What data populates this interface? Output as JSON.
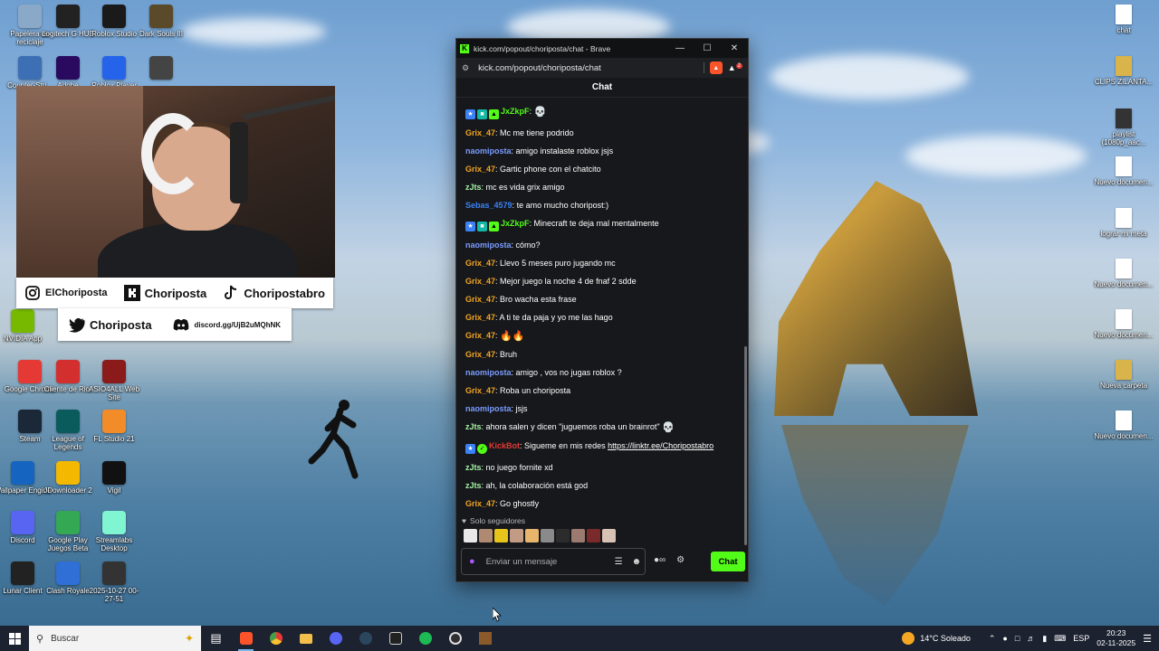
{
  "desktop": {
    "left_icons": [
      {
        "label": "Papelera de reciclaje",
        "icon": "recycle-bin-icon",
        "color": "#8aa9c8"
      },
      {
        "label": "Logitech G HUB",
        "icon": "logitech-icon",
        "color": "#222222"
      },
      {
        "label": "Roblox Studio",
        "icon": "roblox-studio-icon",
        "color": "#1a1a1a"
      },
      {
        "label": "Dark Souls III",
        "icon": "dark-souls-icon",
        "color": "#5a4a2a"
      },
      {
        "label": "Counter-Stri...",
        "icon": "cs-icon",
        "color": "#3c6fb4"
      },
      {
        "label": "Adobe",
        "icon": "premiere-icon",
        "color": "#2a0a5e"
      },
      {
        "label": "Roblox Player",
        "icon": "roblox-icon",
        "color": "#2563eb"
      },
      {
        "label": "...",
        "icon": "video-file-icon",
        "color": "#444444"
      },
      {
        "label": "NVIDIA App",
        "icon": "nvidia-icon",
        "color": "#76b900"
      },
      {
        "label": "Google Chrome",
        "icon": "chrome-icon",
        "color": "#e53935"
      },
      {
        "label": "Cliente de Riot",
        "icon": "riot-icon",
        "color": "#d32f2f"
      },
      {
        "label": "ASIO4ALL Web Site",
        "icon": "asio-icon",
        "color": "#8b1a1a"
      },
      {
        "label": "Steam",
        "icon": "steam-icon",
        "color": "#1b2838"
      },
      {
        "label": "League of Legends",
        "icon": "lol-icon",
        "color": "#0a5c5c"
      },
      {
        "label": "FL Studio 21",
        "icon": "fl-studio-icon",
        "color": "#f28c28"
      },
      {
        "label": "Wallpaper Engine",
        "icon": "wallpaper-engine-icon",
        "color": "#1565c0"
      },
      {
        "label": "JDownloader 2",
        "icon": "jdownloader-icon",
        "color": "#f5b800"
      },
      {
        "label": "Vigil",
        "icon": "vigil-icon",
        "color": "#111111"
      },
      {
        "label": "Discord",
        "icon": "discord-icon",
        "color": "#5865f2"
      },
      {
        "label": "Google Play Juegos Beta",
        "icon": "google-play-icon",
        "color": "#34a853"
      },
      {
        "label": "Streamlabs Desktop",
        "icon": "streamlabs-icon",
        "color": "#80f5d2"
      },
      {
        "label": "Lunar Client",
        "icon": "lunar-icon",
        "color": "#222222"
      },
      {
        "label": "Clash Royale",
        "icon": "clash-royale-icon",
        "color": "#2f6fd6"
      },
      {
        "label": "2025-10-27 00-27-51",
        "icon": "video-file-icon",
        "color": "#333333"
      }
    ],
    "right_icons": [
      {
        "label": "chat",
        "icon": "document-icon",
        "color": "#ffffff"
      },
      {
        "label": "CLIPS ZILANTA...",
        "icon": "folder-zip-icon",
        "color": "#d9b44a"
      },
      {
        "label": "playlist (1080p_aac...",
        "icon": "video-file-icon",
        "color": "#333333"
      },
      {
        "label": "Nuevo documen...",
        "icon": "document-icon",
        "color": "#ffffff"
      },
      {
        "label": "lograr mi meta",
        "icon": "document-icon",
        "color": "#ffffff"
      },
      {
        "label": "Nuevo documen...",
        "icon": "document-icon",
        "color": "#ffffff"
      },
      {
        "label": "Nuevo documen...",
        "icon": "document-icon",
        "color": "#ffffff"
      },
      {
        "label": "Nueva carpeta",
        "icon": "folder-zip-icon",
        "color": "#d9b44a"
      },
      {
        "label": "Nuevo documen...",
        "icon": "document-icon",
        "color": "#ffffff"
      }
    ]
  },
  "overlay": {
    "instagram": "ElChoriposta",
    "kick": "Choriposta",
    "tiktok": "Choripostabro",
    "twitter": "Choriposta",
    "discord": "discord.gg/UjB2uMQhNK"
  },
  "browser": {
    "title": "kick.com/popout/choriposta/chat - Brave",
    "url": "kick.com/popout/choriposta/chat",
    "shield_count": "2",
    "chat_header": "Chat",
    "messages": [
      {
        "user": "JxZkpF",
        "color": "#53fc18",
        "badges": true,
        "text": "",
        "emote": "💀"
      },
      {
        "user": "Grix_47",
        "color": "#f5a623",
        "text": "Mc me tiene podrido"
      },
      {
        "user": "naomiposta",
        "color": "#7c9cff",
        "text": "amigo instalaste roblox jsjs"
      },
      {
        "user": "Grix_47",
        "color": "#f5a623",
        "text": "Gartic phone con el chatcito"
      },
      {
        "user": "zJts",
        "color": "#a6f3a6",
        "text": "mc es vida grix amigo"
      },
      {
        "user": "Sebas_4579",
        "color": "#3b82f6",
        "text": "te amo mucho choripost:)"
      },
      {
        "user": "JxZkpF",
        "color": "#53fc18",
        "badges": true,
        "text": "Minecraft te deja mal mentalmente"
      },
      {
        "user": "naomiposta",
        "color": "#7c9cff",
        "text": "cómo?"
      },
      {
        "user": "Grix_47",
        "color": "#f5a623",
        "text": "Llevo 5 meses puro jugando mc"
      },
      {
        "user": "Grix_47",
        "color": "#f5a623",
        "text": "Mejor juego la noche 4 de fnaf 2 sdde"
      },
      {
        "user": "Grix_47",
        "color": "#f5a623",
        "text": "Bro wacha esta frase"
      },
      {
        "user": "Grix_47",
        "color": "#f5a623",
        "text": "A ti te da paja y yo me las hago"
      },
      {
        "user": "Grix_47",
        "color": "#f5a623",
        "text": "",
        "emote": "🔥🔥"
      },
      {
        "user": "Grix_47",
        "color": "#f5a623",
        "text": "Bruh"
      },
      {
        "user": "naomiposta",
        "color": "#7c9cff",
        "text": "amigo , vos no jugas roblox ?"
      },
      {
        "user": "Grix_47",
        "color": "#f5a623",
        "text": "Roba un choriposta"
      },
      {
        "user": "naomiposta",
        "color": "#7c9cff",
        "text": "jsjs"
      },
      {
        "user": "zJts",
        "color": "#a6f3a6",
        "text": "ahora salen y dicen \"juguemos roba un brainrot\"",
        "emote": "💀"
      },
      {
        "user": "KickBot",
        "color": "#e53935",
        "bot": true,
        "text": "Sigueme en mis redes",
        "link": "https://linktr.ee/Choripostabro"
      },
      {
        "user": "zJts",
        "color": "#a6f3a6",
        "text": "no juego fornite xd"
      },
      {
        "user": "zJts",
        "color": "#a6f3a6",
        "text": "ah, la colaboración está god"
      },
      {
        "user": "Grix_47",
        "color": "#f5a623",
        "text": "Go ghostly"
      }
    ],
    "followers_only": "Solo seguidores",
    "input_placeholder": "Enviar un mensaje",
    "send_label": "Chat"
  },
  "taskbar": {
    "search_placeholder": "Buscar",
    "weather": "14°C  Soleado",
    "language": "ESP",
    "time": "20:23",
    "date": "02-11-2025"
  }
}
